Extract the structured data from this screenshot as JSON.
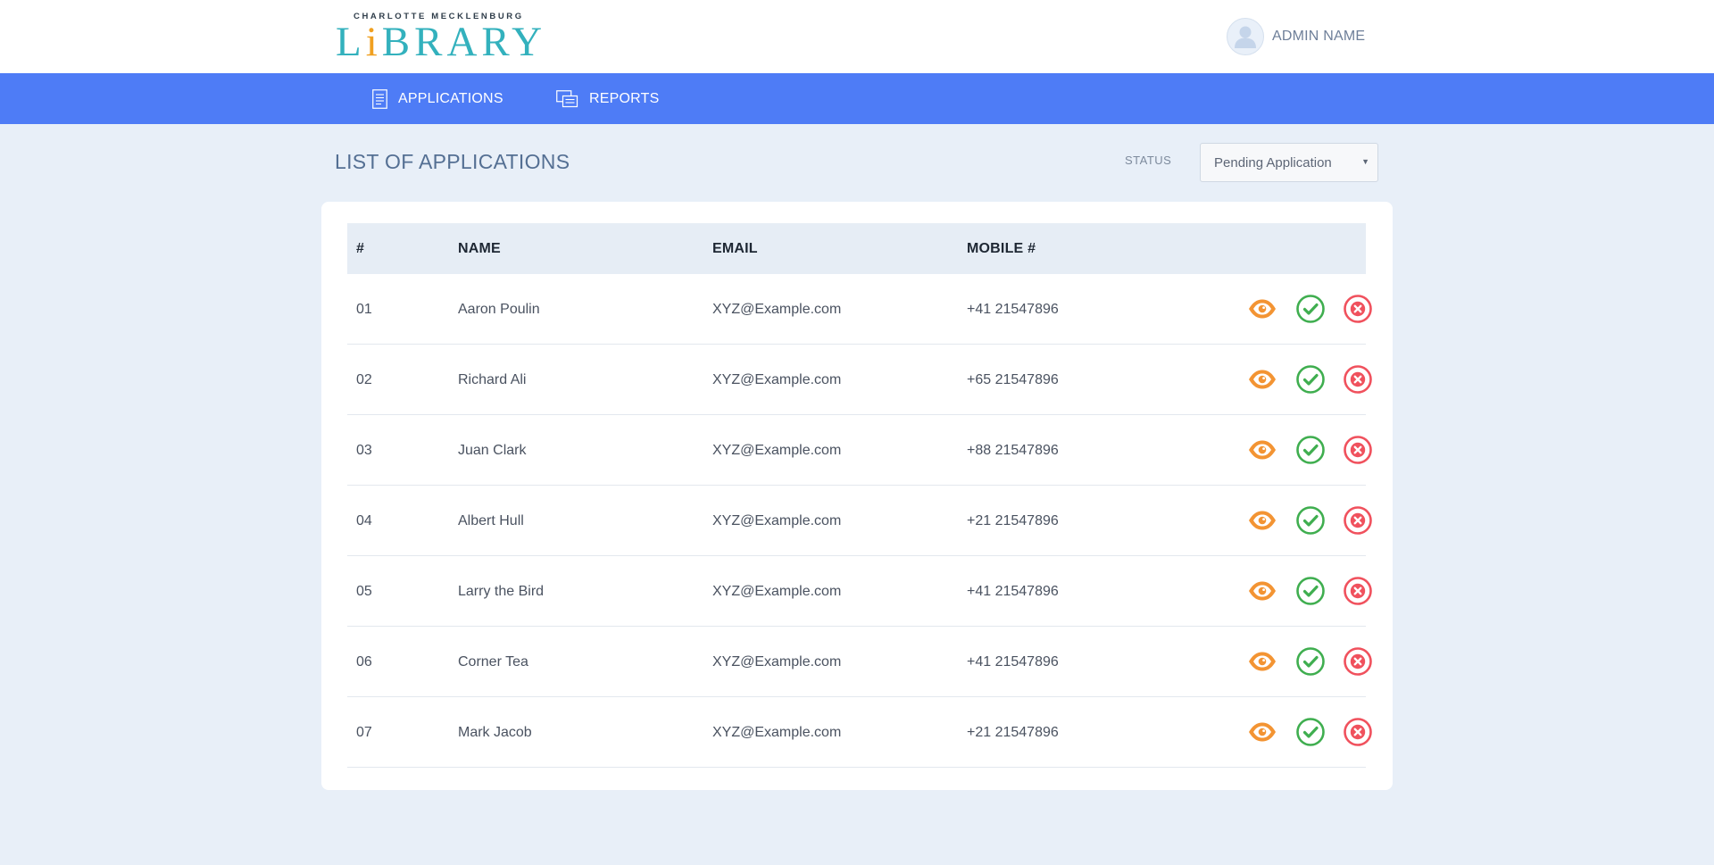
{
  "header": {
    "logo": {
      "top_text": "CHARLOTTE MECKLENBURG",
      "main_text_before": "L",
      "main_text_accent": "i",
      "main_text_after": "BRARY"
    },
    "user": {
      "name": "ADMIN NAME",
      "avatar_icon": "user-avatar-icon"
    }
  },
  "nav": {
    "items": [
      {
        "label": "APPLICATIONS",
        "icon": "document-icon"
      },
      {
        "label": "REPORTS",
        "icon": "reports-icon"
      }
    ]
  },
  "page": {
    "title": "LIST OF APPLICATIONS",
    "status_filter": {
      "label": "STATUS",
      "selected": "Pending Application"
    }
  },
  "table": {
    "columns": [
      "#",
      "NAME",
      "EMAIL",
      "MOBILE #"
    ],
    "rows": [
      {
        "num": "01",
        "name": "Aaron Poulin",
        "email": "XYZ@Example.com",
        "mobile": "+41 21547896"
      },
      {
        "num": "02",
        "name": "Richard Ali",
        "email": "XYZ@Example.com",
        "mobile": "+65 21547896"
      },
      {
        "num": "03",
        "name": "Juan Clark",
        "email": "XYZ@Example.com",
        "mobile": "+88 21547896"
      },
      {
        "num": "04",
        "name": "Albert Hull",
        "email": "XYZ@Example.com",
        "mobile": "+21 21547896"
      },
      {
        "num": "05",
        "name": "Larry the Bird",
        "email": "XYZ@Example.com",
        "mobile": "+41 21547896"
      },
      {
        "num": "06",
        "name": "Corner Tea",
        "email": "XYZ@Example.com",
        "mobile": "+41 21547896"
      },
      {
        "num": "07",
        "name": "Mark Jacob",
        "email": "XYZ@Example.com",
        "mobile": "+21 21547896"
      }
    ],
    "actions": [
      {
        "name": "view",
        "icon": "eye-icon",
        "color": "#f39433"
      },
      {
        "name": "approve",
        "icon": "check-circle-icon",
        "color": "#3fae4f"
      },
      {
        "name": "reject",
        "icon": "x-circle-icon",
        "color": "#f0515d"
      }
    ]
  },
  "colors": {
    "navbar": "#4e7cf6",
    "page_background": "#e8eff8",
    "logo_teal": "#33b1bd",
    "table_header": "#e6edf5"
  }
}
